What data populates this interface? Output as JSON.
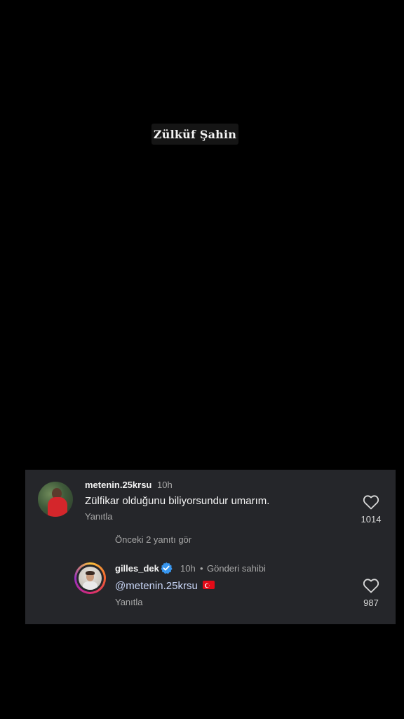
{
  "overlay": {
    "title": "Zülküf Şahin"
  },
  "comment": {
    "username": "metenin.25krsu",
    "time": "10h",
    "text": "Zülfikar olduğunu biliyorsundur umarım.",
    "reply_label": "Yanıtla",
    "likes": "1014"
  },
  "view_previous": "Önceki 2 yanıtı gör",
  "reply": {
    "username": "gilles_dek",
    "time": "10h",
    "separator": "•",
    "author_tag": "Gönderi sahibi",
    "mention": "@metenin.25krsu",
    "reply_label": "Yanıtla",
    "likes": "987",
    "verified": true,
    "flag_icon": "turkey-flag-icon"
  },
  "colors": {
    "background": "#000000",
    "card": "#25262a",
    "verified_blue": "#3897f0",
    "mention": "#c9d6f7"
  }
}
